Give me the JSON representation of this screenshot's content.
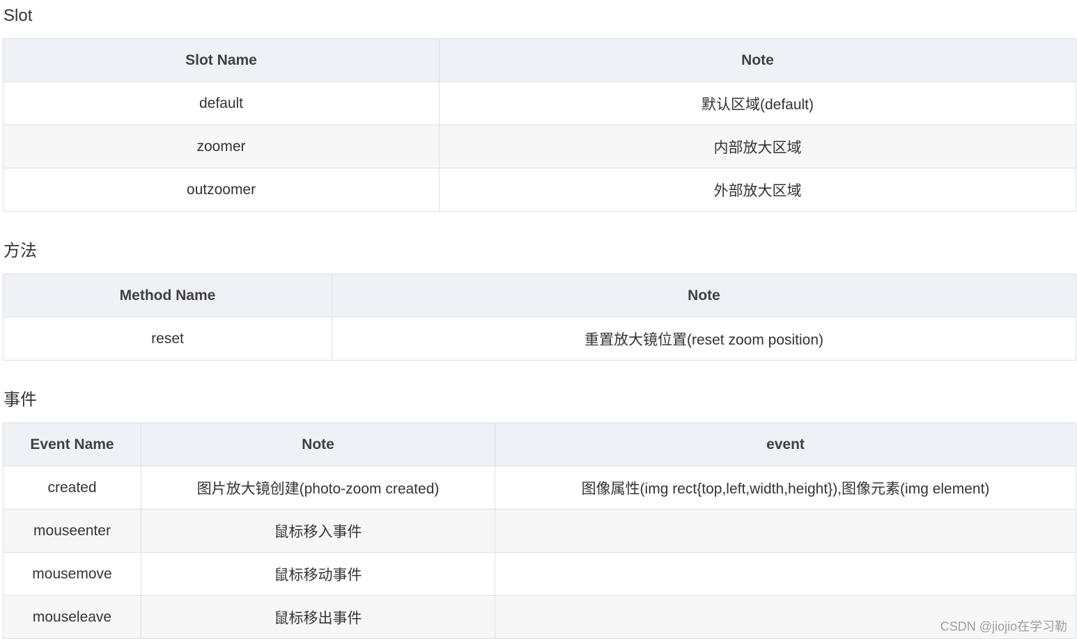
{
  "slot": {
    "title": "Slot",
    "headers": [
      "Slot Name",
      "Note"
    ],
    "rows": [
      [
        "default",
        "默认区域(default)"
      ],
      [
        "zoomer",
        "内部放大区域"
      ],
      [
        "outzoomer",
        "外部放大区域"
      ]
    ]
  },
  "methods": {
    "title": "方法",
    "headers": [
      "Method Name",
      "Note"
    ],
    "rows": [
      [
        "reset",
        "重置放大镜位置(reset zoom position)"
      ]
    ]
  },
  "events": {
    "title": "事件",
    "headers": [
      "Event Name",
      "Note",
      "event"
    ],
    "rows": [
      [
        "created",
        "图片放大镜创建(photo-zoom created)",
        "图像属性(img rect{top,left,width,height}),图像元素(img element)"
      ],
      [
        "mouseenter",
        "鼠标移入事件",
        ""
      ],
      [
        "mousemove",
        "鼠标移动事件",
        ""
      ],
      [
        "mouseleave",
        "鼠标移出事件",
        ""
      ]
    ]
  },
  "watermark": "CSDN @jiojio在学习勒"
}
